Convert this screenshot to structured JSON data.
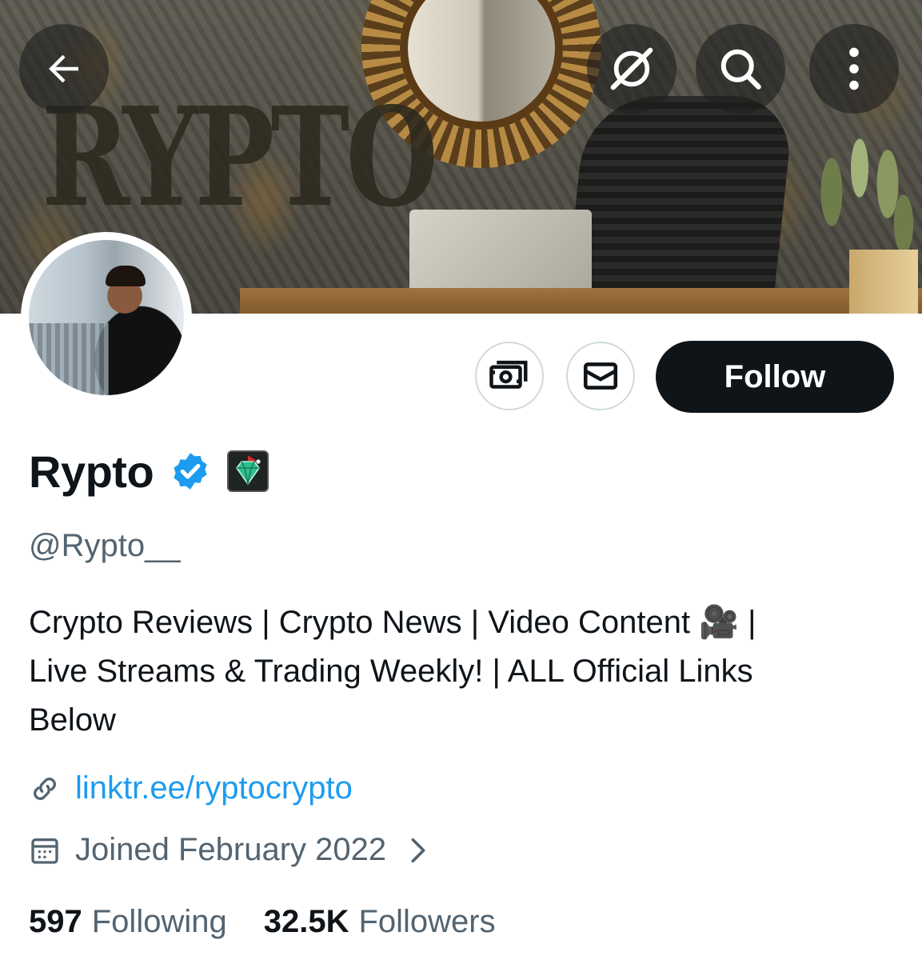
{
  "banner": {
    "word": "RYPTO"
  },
  "header": {
    "back_icon": "arrow-left-icon",
    "grok_icon": "grok-icon",
    "search_icon": "search-icon",
    "more_icon": "more-vertical-icon"
  },
  "actions": {
    "subscribe_icon": "money-icon",
    "message_icon": "mail-icon",
    "follow_label": "Follow"
  },
  "profile": {
    "display_name": "Rypto",
    "handle": "@Rypto__",
    "bio_line1": "Crypto Reviews | Crypto News | Video Content 🎥 |",
    "bio_line2": "Live Streams & Trading Weekly! | ALL Official Links",
    "bio_line3": "Below",
    "link": "linktr.ee/ryptocrypto",
    "joined": "Joined February 2022"
  },
  "stats": {
    "following_count": "597",
    "following_label": "Following",
    "followers_count": "32.5K",
    "followers_label": "Followers"
  },
  "colors": {
    "accent": "#1d9bf0",
    "text_primary": "#0f1419",
    "text_secondary": "#536471",
    "follow_bg": "#0f1419"
  }
}
